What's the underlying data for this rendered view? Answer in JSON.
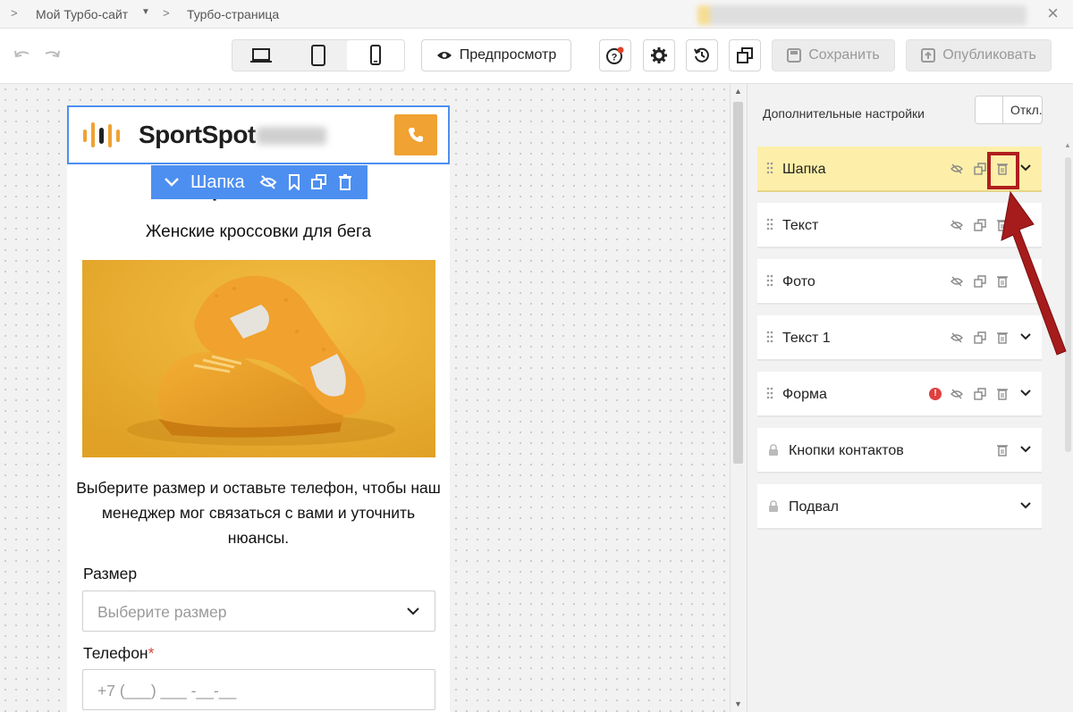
{
  "breadcrumb": {
    "site": "Мой Турбо-сайт",
    "page": "Турбо-страница"
  },
  "toolbar": {
    "devices": [
      "desktop",
      "tablet",
      "mobile"
    ],
    "active_device": "mobile",
    "preview_label": "Предпросмотр",
    "save_label": "Сохранить",
    "publish_label": "Опубликовать"
  },
  "preview": {
    "logo_text": "SportSpot",
    "title_partial": "Superfeet MX-6",
    "subtitle": "Женские кроссовки для бега",
    "description": "Выберите размер и оставьте телефон, чтобы наш менеджер мог связаться с вами и уточнить нюансы.",
    "size_label": "Размер",
    "size_placeholder": "Выберите размер",
    "phone_label": "Телефон",
    "phone_required_mark": "*",
    "phone_placeholder": "+7 (___) ___ -__-__",
    "block_toolbar_label": "Шапка"
  },
  "panel": {
    "advanced_label": "Дополнительные настройки",
    "toggle_label": "Откл.",
    "blocks": [
      {
        "name": "Шапка",
        "active": true
      },
      {
        "name": "Текст"
      },
      {
        "name": "Фото"
      },
      {
        "name": "Текст 1"
      },
      {
        "name": "Форма",
        "has_error": true
      },
      {
        "name": "Кнопки контактов",
        "locked": true
      },
      {
        "name": "Подвал",
        "locked": true
      }
    ]
  },
  "colors": {
    "accent": "#4d8ff0",
    "brand": "#f0a232",
    "active_block": "#fdefa9",
    "annotation": "#b01e1e"
  }
}
